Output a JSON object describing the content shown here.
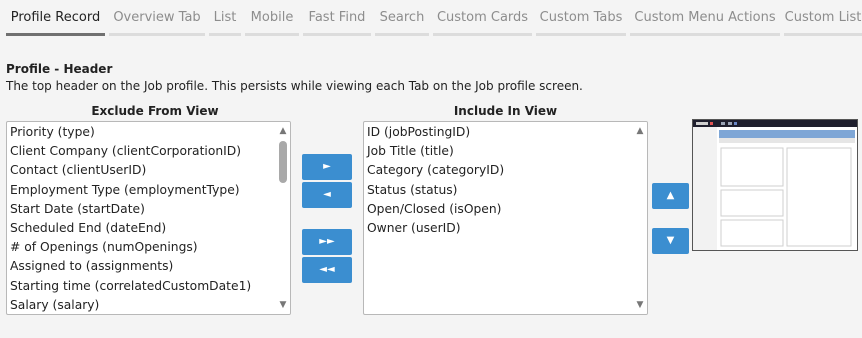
{
  "tabs": [
    {
      "label": "Profile Record",
      "active": true
    },
    {
      "label": "Overview Tab",
      "active": false
    },
    {
      "label": "List",
      "active": false
    },
    {
      "label": "Mobile",
      "active": false
    },
    {
      "label": "Fast Find",
      "active": false
    },
    {
      "label": "Search",
      "active": false
    },
    {
      "label": "Custom Cards",
      "active": false
    },
    {
      "label": "Custom Tabs",
      "active": false
    },
    {
      "label": "Custom Menu Actions",
      "active": false
    },
    {
      "label": "Custom List",
      "active": false
    }
  ],
  "section": {
    "title": "Profile - Header",
    "description": "The top header on the Job profile. This persists while viewing each Tab on the Job profile screen."
  },
  "exclude": {
    "heading": "Exclude From View",
    "items": [
      "Priority (type)",
      "Client Company (clientCorporationID)",
      "Contact (clientUserID)",
      "Employment Type (employmentType)",
      "Start Date (startDate)",
      "Scheduled End (dateEnd)",
      "# of Openings (numOpenings)",
      "Assigned to (assignments)",
      "Starting time (correlatedCustomDate1)",
      "Salary (salary)"
    ]
  },
  "include": {
    "heading": "Include In View",
    "items": [
      "ID (jobPostingID)",
      "Job Title (title)",
      "Category (categoryID)",
      "Status (status)",
      "Open/Closed (isOpen)",
      "Owner (userID)"
    ]
  },
  "buttons": {
    "move_right": "►",
    "move_left": "◄",
    "move_all_right": "►►",
    "move_all_left": "◄◄",
    "move_up": "▲",
    "move_down": "▼"
  },
  "icons": {
    "scroll_up": "▲",
    "scroll_down": "▼"
  },
  "colors": {
    "accent": "#3b8ed0",
    "preview_header": "#7ea6d6",
    "preview_topbar": "#1f1f2e"
  }
}
